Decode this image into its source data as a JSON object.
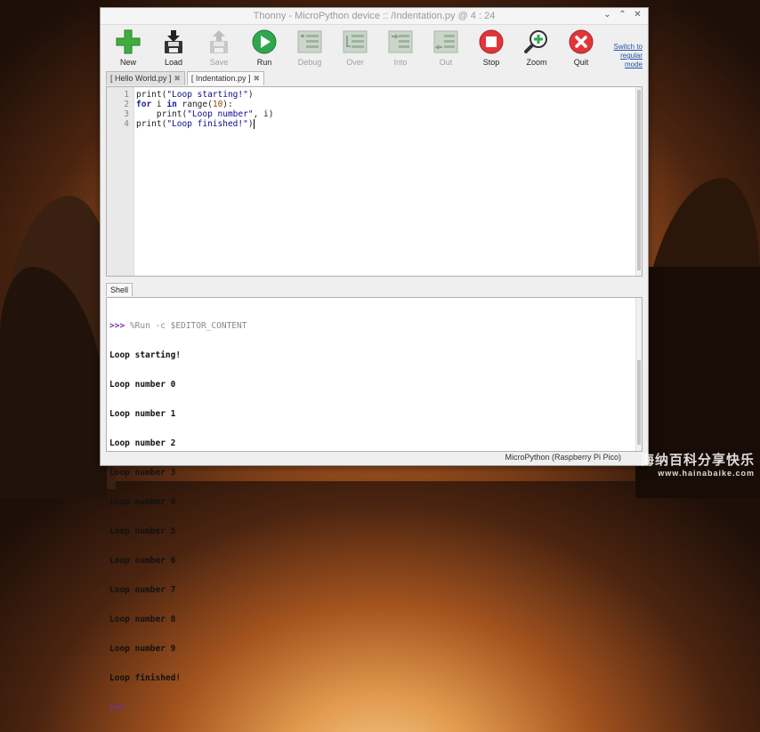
{
  "window": {
    "title": "Thonny  -  MicroPython device :: /Indentation.py  @  4 : 24",
    "controls": [
      "⌄",
      "⌃",
      "✕"
    ]
  },
  "toolbar": {
    "buttons": [
      {
        "label": "New",
        "icon": "plus-icon",
        "enabled": true
      },
      {
        "label": "Load",
        "icon": "floppy-icon",
        "enabled": true
      },
      {
        "label": "Save",
        "icon": "save-icon",
        "enabled": false
      },
      {
        "label": "Run",
        "icon": "play-icon",
        "enabled": true
      },
      {
        "label": "Debug",
        "icon": "debug-icon",
        "enabled": false
      },
      {
        "label": "Over",
        "icon": "step-over-icon",
        "enabled": false
      },
      {
        "label": "Into",
        "icon": "step-into-icon",
        "enabled": false
      },
      {
        "label": "Out",
        "icon": "step-out-icon",
        "enabled": false
      },
      {
        "label": "Stop",
        "icon": "stop-icon",
        "enabled": true
      },
      {
        "label": "Zoom",
        "icon": "zoom-icon",
        "enabled": true
      },
      {
        "label": "Quit",
        "icon": "quit-icon",
        "enabled": true
      }
    ],
    "switch_mode": [
      "Switch to",
      "regular",
      "mode"
    ]
  },
  "tabs": [
    {
      "label": "[ Hello World.py ]",
      "active": false
    },
    {
      "label": "[ Indentation.py ]",
      "active": true
    }
  ],
  "editor": {
    "line_numbers": [
      "1",
      "2",
      "3",
      "4"
    ]
  },
  "shell": {
    "tab_label": "Shell",
    "prompt": ">>>",
    "command": "%Run -c $EDITOR_CONTENT",
    "output": [
      "Loop starting!",
      "Loop number 0",
      "Loop number 1",
      "Loop number 2",
      "Loop number 3",
      "Loop number 4",
      "Loop number 5",
      "Loop number 6",
      "Loop number 7",
      "Loop number 8",
      "Loop number 9",
      "Loop finished!"
    ]
  },
  "status": {
    "interpreter": "MicroPython (Raspberry Pi Pico)"
  },
  "watermark": {
    "cn": "海纳百科分享快乐",
    "url": "www.hainabaike.com"
  },
  "colors": {
    "new_green": "#3fae3f",
    "run_green": "#2ea84e",
    "stop_red": "#e0363a",
    "quit_red": "#e0363a",
    "prompt_purple": "#7a2fa8"
  }
}
